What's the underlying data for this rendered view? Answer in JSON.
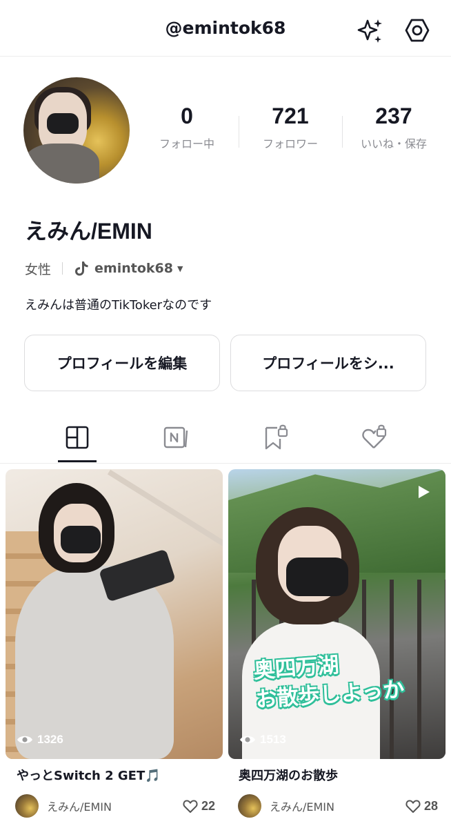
{
  "header": {
    "title": "@emintok68"
  },
  "stats": [
    {
      "value": "0",
      "label": "フォロー中"
    },
    {
      "value": "721",
      "label": "フォロワー"
    },
    {
      "value": "237",
      "label": "いいね・保存"
    }
  ],
  "profile": {
    "name": "えみん/EMIN",
    "gender": "女性",
    "tiktok_handle": "emintok68",
    "bio": "えみんは普通のTikTokerなのです"
  },
  "buttons": {
    "edit": "プロフィールを編集",
    "share": "プロフィールをシ..."
  },
  "posts": [
    {
      "views": "1326",
      "caption": "やっとSwitch 2 GET🎵",
      "author": "えみん/EMIN",
      "likes": "22"
    },
    {
      "views": "1513",
      "caption": "奥四万湖のお散歩",
      "author": "えみん/EMIN",
      "likes": "28",
      "overlay_line1": "奥四万湖",
      "overlay_line2": "お散歩しよっか"
    }
  ],
  "colors": {
    "text": "#161823",
    "muted": "#8a8b91",
    "overlay_outline": "#2fbf9a"
  }
}
